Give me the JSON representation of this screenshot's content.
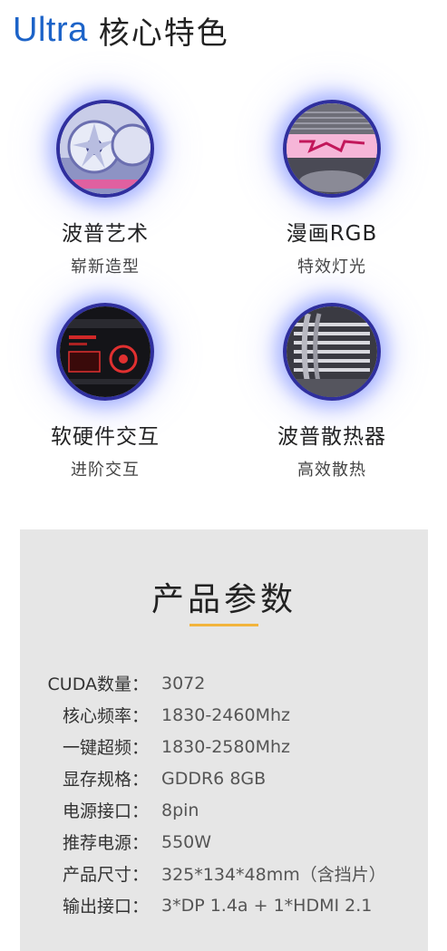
{
  "header": {
    "brand": "Ultra",
    "title": "核心特色"
  },
  "features": [
    {
      "icon": "graphics-card-front-icon",
      "title": "波普艺术",
      "subtitle": "崭新造型"
    },
    {
      "icon": "rgb-lighting-icon",
      "title": "漫画RGB",
      "subtitle": "特效灯光"
    },
    {
      "icon": "software-display-icon",
      "title": "软硬件交互",
      "subtitle": "进阶交互"
    },
    {
      "icon": "heatsink-icon",
      "title": "波普散热器",
      "subtitle": "高效散热"
    }
  ],
  "specs": {
    "title": "产品参数",
    "accent_color": "#f2b43c",
    "rows": [
      {
        "label": "CUDA数量：",
        "value": "3072"
      },
      {
        "label": "核心频率：",
        "value": "1830-2460Mhz"
      },
      {
        "label": "一键超频：",
        "value": "1830-2580Mhz"
      },
      {
        "label": "显存规格：",
        "value": "GDDR6 8GB"
      },
      {
        "label": "电源接口：",
        "value": "8pin"
      },
      {
        "label": "推荐电源：",
        "value": "550W"
      },
      {
        "label": "产品尺寸：",
        "value": "325*134*48mm（含挡片）"
      },
      {
        "label": "输出接口：",
        "value": "3*DP 1.4a + 1*HDMI 2.1"
      }
    ]
  }
}
